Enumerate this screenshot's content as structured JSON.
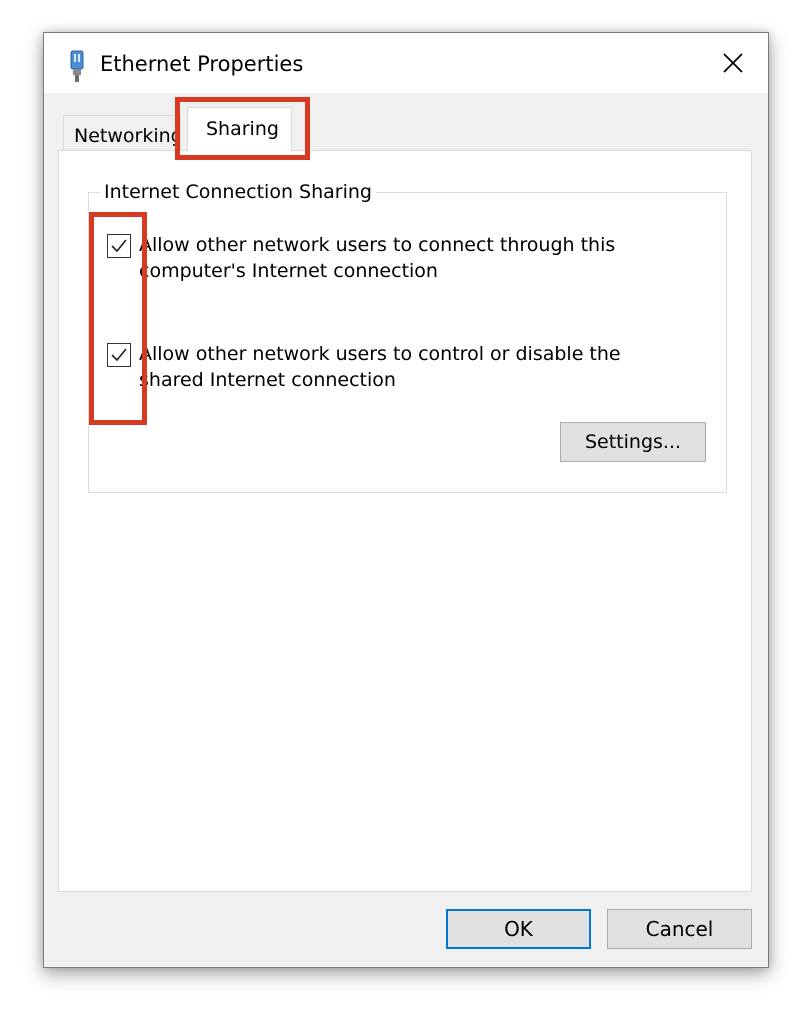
{
  "window": {
    "title": "Ethernet Properties",
    "icon": "ethernet-adapter-icon",
    "close_icon": "close-icon"
  },
  "tabs": [
    {
      "label": "Networking",
      "selected": false
    },
    {
      "label": "Sharing",
      "selected": true
    }
  ],
  "sharing": {
    "group_label": "Internet Connection Sharing",
    "options": [
      {
        "label": "Allow other network users to connect through this computer's Internet connection",
        "checked": true
      },
      {
        "label": "Allow other network users to control or disable the shared Internet connection",
        "checked": true
      }
    ],
    "settings_label": "Settings..."
  },
  "buttons": {
    "ok_label": "OK",
    "cancel_label": "Cancel"
  },
  "colors": {
    "highlight": "#d63a22",
    "default_button_border": "#0078d7",
    "dialog_background": "#f0f0f0"
  }
}
